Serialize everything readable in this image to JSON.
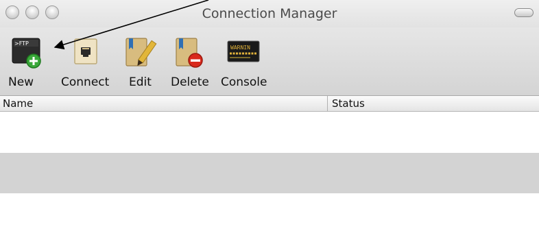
{
  "window": {
    "title": "Connection Manager"
  },
  "toolbar": {
    "items": [
      {
        "label": "New",
        "icon": "new-ftp-connection-icon"
      },
      {
        "label": "Connect",
        "icon": "network-jack-icon"
      },
      {
        "label": "Edit",
        "icon": "edit-bookmark-icon"
      },
      {
        "label": "Delete",
        "icon": "delete-bookmark-icon"
      },
      {
        "label": "Console",
        "icon": "console-log-icon"
      }
    ],
    "new_icon_text": ">FTP",
    "console_icon_text": "WARNIN"
  },
  "table": {
    "columns": [
      "Name",
      "Status"
    ],
    "rows": []
  },
  "colors": {
    "accent_green": "#3aa83a",
    "delete_red": "#d9291c",
    "stripe": "#d3d3d3"
  }
}
